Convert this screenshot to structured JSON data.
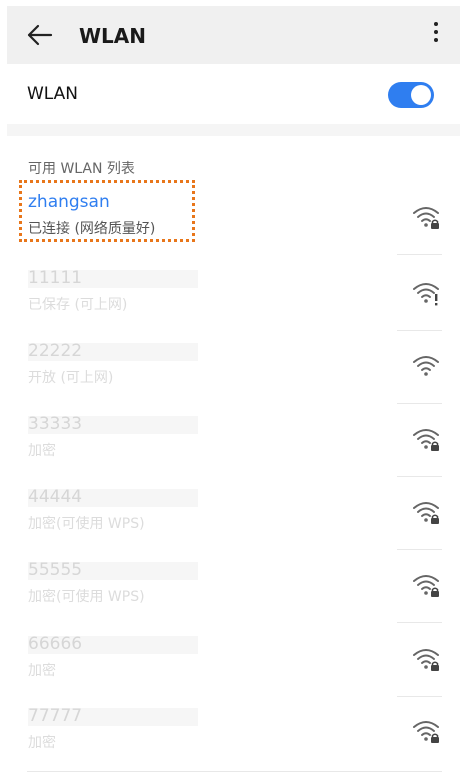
{
  "header": {
    "title": "WLAN"
  },
  "wlan": {
    "label": "WLAN",
    "enabled": true
  },
  "list": {
    "section_title": "可用 WLAN 列表",
    "networks": [
      {
        "name": "zhangsan",
        "status": "已连接 (网络质量好)",
        "icon": "wifi-lock-icon"
      },
      {
        "name": "11111",
        "status": "已保存 (可上网)",
        "icon": "wifi-alert-icon"
      },
      {
        "name": "22222",
        "status": "开放 (可上网)",
        "icon": "wifi-open-icon"
      },
      {
        "name": "33333",
        "status": "加密",
        "icon": "wifi-lock-icon"
      },
      {
        "name": "44444",
        "status": "加密(可使用 WPS)",
        "icon": "wifi-lock-icon"
      },
      {
        "name": "55555",
        "status": "加密(可使用 WPS)",
        "icon": "wifi-lock-icon"
      },
      {
        "name": "66666",
        "status": "加密",
        "icon": "wifi-lock-icon"
      },
      {
        "name": "77777",
        "status": "加密",
        "icon": "wifi-lock-icon"
      }
    ]
  },
  "colors": {
    "accent": "#2f7ef0",
    "highlight": "#e8761a"
  }
}
